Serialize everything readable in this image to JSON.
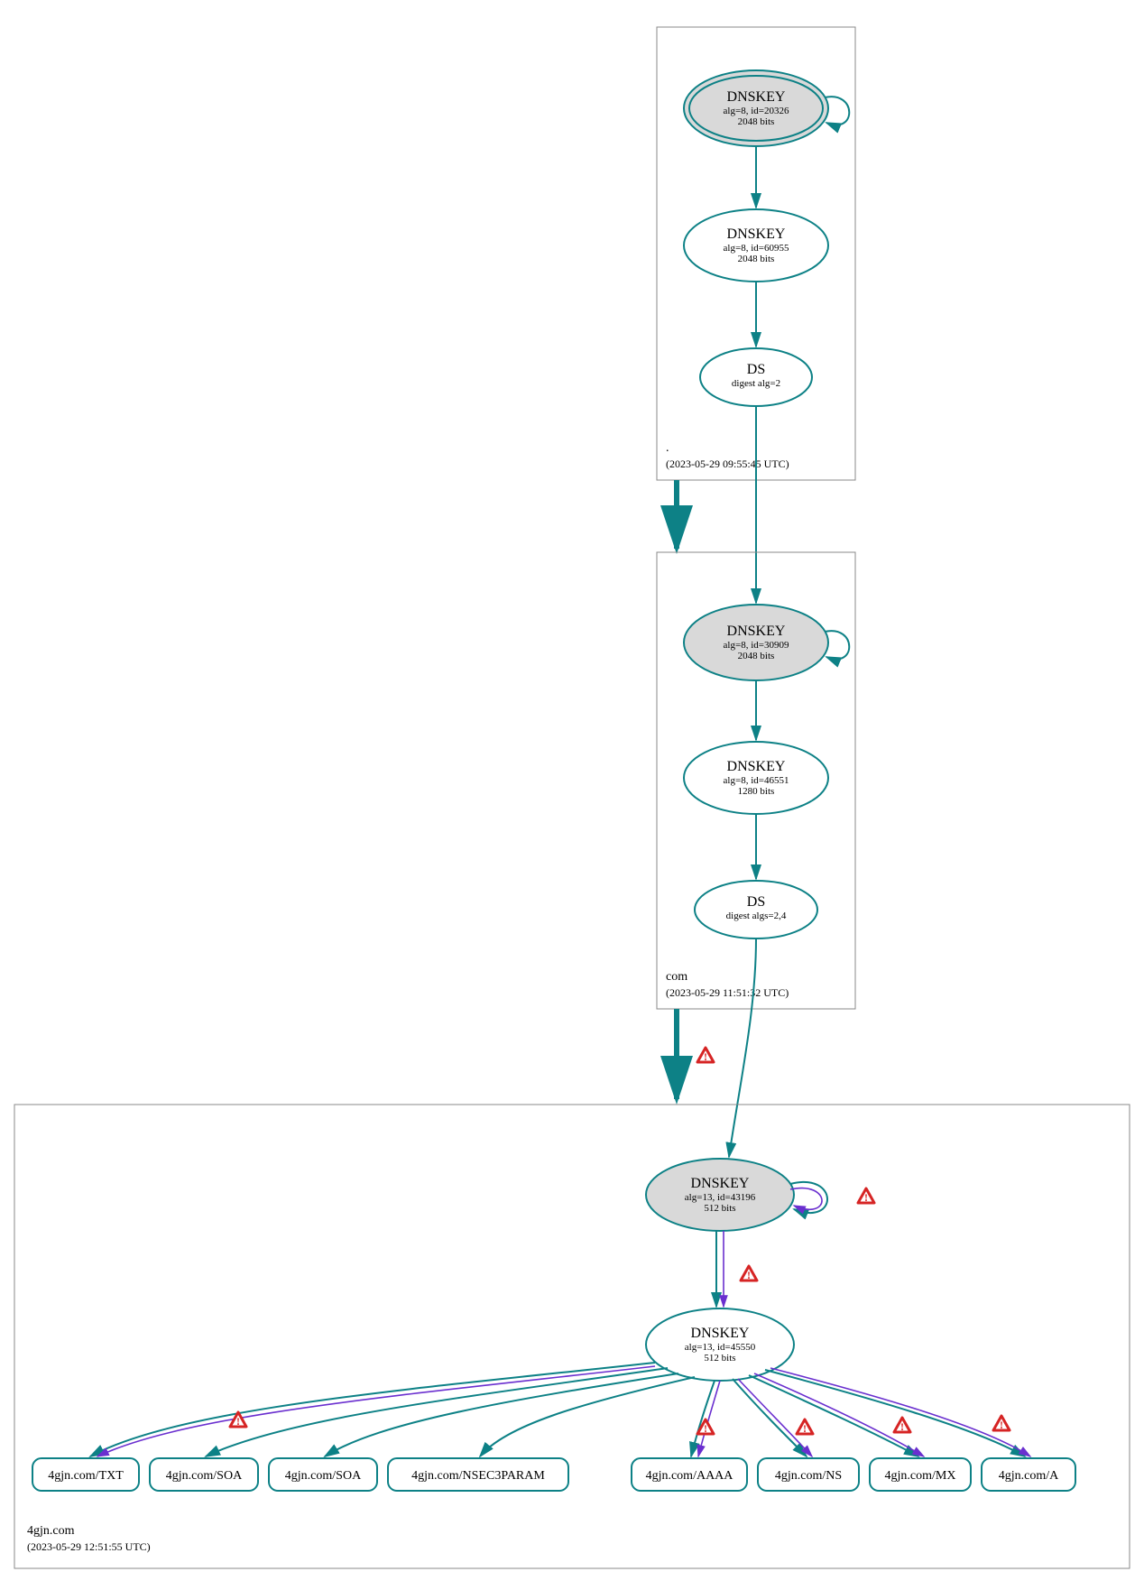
{
  "colors": {
    "teal": "#0d8186",
    "purple": "#6a2fcf",
    "grey_fill": "#d9d9d9",
    "warn_red": "#d62424",
    "box_grey": "#888888"
  },
  "zones": {
    "root": {
      "label": ".",
      "timestamp": "(2023-05-29 09:55:45 UTC)",
      "dnskey_ksk": {
        "title": "DNSKEY",
        "line1": "alg=8, id=20326",
        "line2": "2048 bits"
      },
      "dnskey_zsk": {
        "title": "DNSKEY",
        "line1": "alg=8, id=60955",
        "line2": "2048 bits"
      },
      "ds": {
        "title": "DS",
        "line1": "digest alg=2"
      }
    },
    "com": {
      "label": "com",
      "timestamp": "(2023-05-29 11:51:32 UTC)",
      "dnskey_ksk": {
        "title": "DNSKEY",
        "line1": "alg=8, id=30909",
        "line2": "2048 bits"
      },
      "dnskey_zsk": {
        "title": "DNSKEY",
        "line1": "alg=8, id=46551",
        "line2": "1280 bits"
      },
      "ds": {
        "title": "DS",
        "line1": "digest algs=2,4"
      }
    },
    "domain": {
      "label": "4gjn.com",
      "timestamp": "(2023-05-29 12:51:55 UTC)",
      "dnskey_ksk": {
        "title": "DNSKEY",
        "line1": "alg=13, id=43196",
        "line2": "512 bits"
      },
      "dnskey_zsk": {
        "title": "DNSKEY",
        "line1": "alg=13, id=45550",
        "line2": "512 bits"
      },
      "rrsets": [
        "4gjn.com/TXT",
        "4gjn.com/SOA",
        "4gjn.com/SOA",
        "4gjn.com/NSEC3PARAM",
        "4gjn.com/AAAA",
        "4gjn.com/NS",
        "4gjn.com/MX",
        "4gjn.com/A"
      ]
    }
  }
}
